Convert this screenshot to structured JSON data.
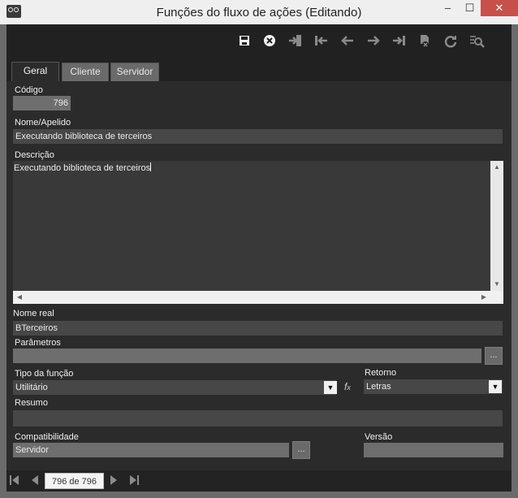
{
  "window": {
    "title": "Funções do fluxo de ações (Editando)",
    "minimize": "–",
    "maximize": "☐",
    "close": "✕"
  },
  "toolbar": {
    "icons": [
      "save-icon",
      "cancel-icon",
      "import-icon",
      "first-record-icon",
      "previous-icon",
      "next-icon",
      "last-record-icon",
      "delete-icon",
      "refresh-icon",
      "search-icon"
    ]
  },
  "tabs": [
    {
      "label": "Geral",
      "active": true
    },
    {
      "label": "Cliente",
      "active": false
    },
    {
      "label": "Servidor",
      "active": false
    }
  ],
  "form": {
    "codigo": {
      "label": "Código",
      "value": "796"
    },
    "nome": {
      "label": "Nome/Apelido",
      "value": "Executando biblioteca de terceiros"
    },
    "descricao": {
      "label": "Descrição",
      "value": "Executando biblioteca de terceiros"
    },
    "nome_real": {
      "label": "Nome real",
      "value": "BTerceiros"
    },
    "parametros": {
      "label": "Parâmetros",
      "value": "",
      "button": "..."
    },
    "tipo_funcao": {
      "label": "Tipo da função",
      "value": "Utilitário"
    },
    "retorno": {
      "label": "Retorno",
      "value": "Letras"
    },
    "resumo": {
      "label": "Resumo",
      "value": ""
    },
    "compatibilidade": {
      "label": "Compatibilidade",
      "value": "Servidor",
      "button": "..."
    },
    "versao": {
      "label": "Versão",
      "value": ""
    }
  },
  "navigator": {
    "position": "796 de 796"
  },
  "colors": {
    "background": "#2b2b2b",
    "toolbar": "#212121",
    "field": "#474747",
    "close_button": "#c7504b"
  }
}
